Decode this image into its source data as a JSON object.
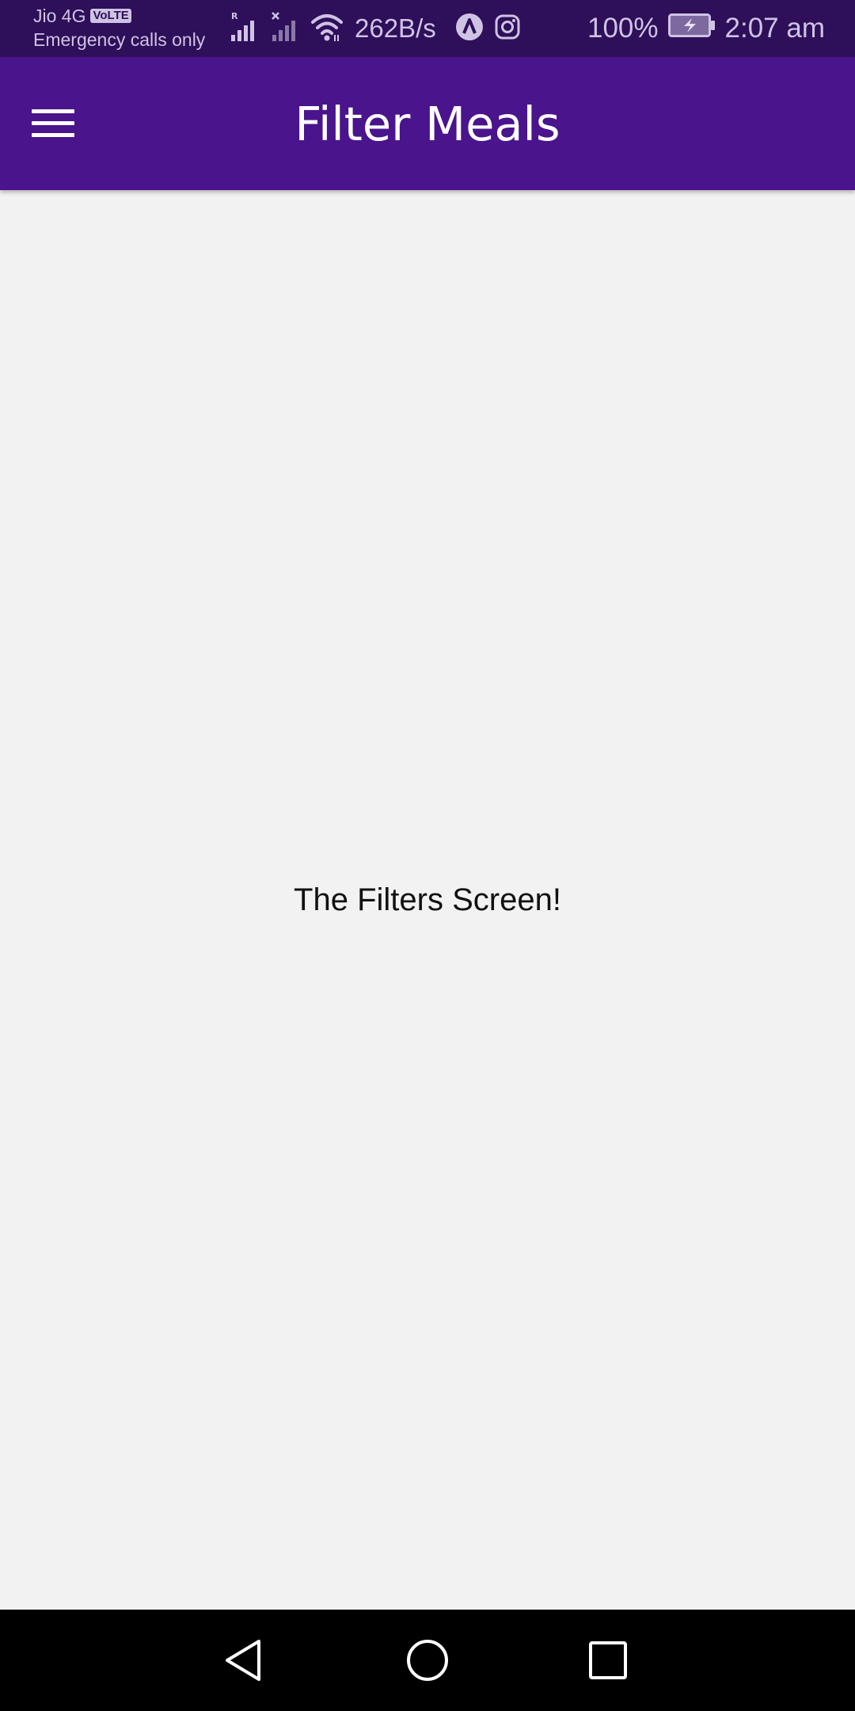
{
  "status_bar": {
    "carrier": "Jio 4G",
    "volte_badge": "VoLTE",
    "emergency_text": "Emergency calls only",
    "signal_roaming_marker": "R",
    "net_speed": "262B/s",
    "battery_percent": "100%",
    "time": "2:07 am",
    "icons": [
      "signal-roaming-icon",
      "signal-no-sim-icon",
      "wifi-icon",
      "app-notification-icon",
      "instagram-icon",
      "battery-charging-icon"
    ]
  },
  "app_bar": {
    "title": "Filter Meals",
    "menu_icon": "hamburger-menu-icon",
    "color": "#4a148c"
  },
  "content": {
    "message": "The Filters Screen!"
  },
  "nav_bar": {
    "icons": [
      "back-icon",
      "home-icon",
      "recents-icon"
    ]
  }
}
